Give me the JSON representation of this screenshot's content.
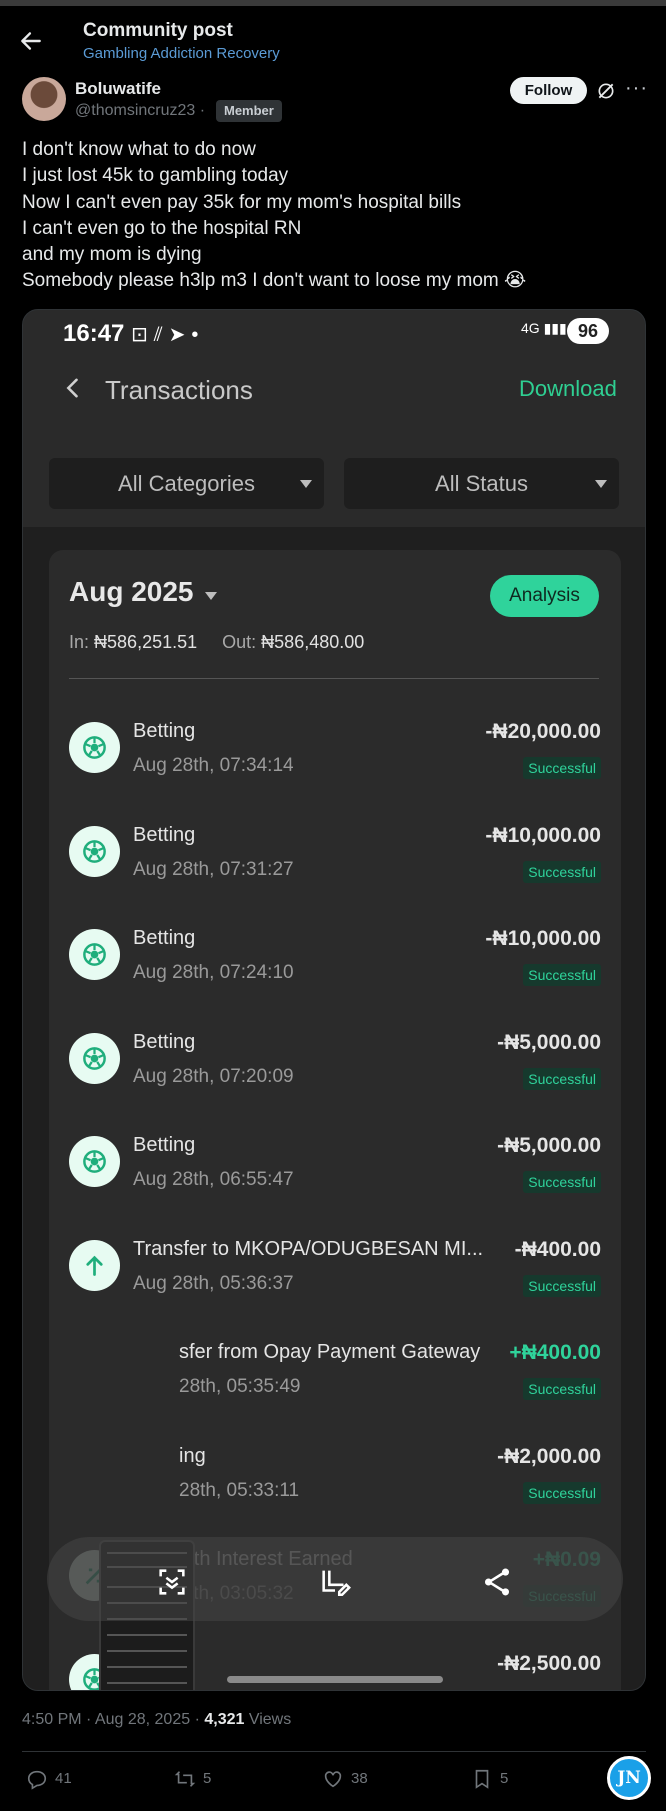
{
  "header": {
    "title": "Community post",
    "community": "Gambling Addiction Recovery"
  },
  "author": {
    "name": "Boluwatife",
    "handle": "@thomsincruz23 ·",
    "badge": "Member",
    "follow_label": "Follow"
  },
  "post": {
    "lines": [
      "I don't know what to do now",
      "I just lost 45k to gambling today",
      "Now I can't even pay 35k for my mom's hospital bills",
      "I can't even go to the hospital RN",
      "and my mom is dying",
      "Somebody please h3lp m3 I don't want to loose my mom 😭"
    ]
  },
  "screenshot": {
    "status_time": "16:47",
    "status_network": "4G",
    "battery": "96",
    "title": "Transactions",
    "download_label": "Download",
    "filter_categories": "All Categories",
    "filter_status": "All Status",
    "month": "Aug 2025",
    "analysis_label": "Analysis",
    "in_label": "In:",
    "in_value": "₦586,251.51",
    "out_label": "Out:",
    "out_value": "₦586,480.00",
    "transactions": [
      {
        "title": "Betting",
        "date": "Aug 28th, 07:34:14",
        "amount": "-₦20,000.00",
        "status": "Successful",
        "icon": "betting-icon"
      },
      {
        "title": "Betting",
        "date": "Aug 28th, 07:31:27",
        "amount": "-₦10,000.00",
        "status": "Successful",
        "icon": "betting-icon"
      },
      {
        "title": "Betting",
        "date": "Aug 28th, 07:24:10",
        "amount": "-₦10,000.00",
        "status": "Successful",
        "icon": "betting-icon"
      },
      {
        "title": "Betting",
        "date": "Aug 28th, 07:20:09",
        "amount": "-₦5,000.00",
        "status": "Successful",
        "icon": "betting-icon"
      },
      {
        "title": "Betting",
        "date": "Aug 28th, 06:55:47",
        "amount": "-₦5,000.00",
        "status": "Successful",
        "icon": "betting-icon"
      },
      {
        "title": "Transfer to MKOPA/ODUGBESAN MI...",
        "date": "Aug 28th, 05:36:37",
        "amount": "-₦400.00",
        "status": "Successful",
        "icon": "arrow-up-icon"
      },
      {
        "title": "sfer from Opay Payment Gateway",
        "date": "28th, 05:35:49",
        "amount": "+₦400.00",
        "status": "Successful",
        "icon": "arrow-down-icon"
      },
      {
        "title": "ing",
        "date": "28th, 05:33:11",
        "amount": "-₦2,000.00",
        "status": "Successful",
        "icon": "betting-icon"
      },
      {
        "title": "OWealth Interest Earned",
        "date": "Aug 28th, 03:05:32",
        "amount": "+₦0.09",
        "status": "Successful",
        "icon": "interest-icon"
      },
      {
        "title": "Betting",
        "date": "",
        "amount": "-₦2,500.00",
        "status": "",
        "icon": "betting-icon"
      }
    ]
  },
  "meta": {
    "time": "4:50 PM · Aug 28, 2025 · ",
    "views": "4,321",
    "views_label": " Views"
  },
  "actions": {
    "replies": "41",
    "reposts": "5",
    "likes": "38",
    "bookmarks": "5"
  },
  "watermark": "JN",
  "colors": {
    "accent_green": "#2fd39b",
    "link_blue": "#5b9bd5",
    "background": "#000000"
  }
}
